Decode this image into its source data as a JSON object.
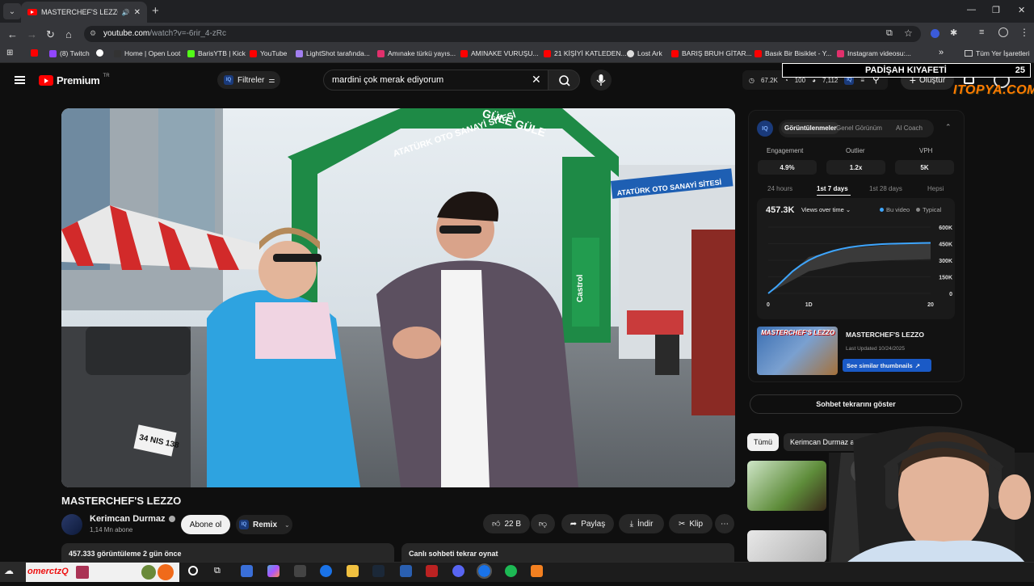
{
  "browser": {
    "tab_title": "MASTERCHEF'S LEZZO - Yo",
    "new_tab": "+",
    "url_host": "youtube.com",
    "url_path": "/watch?v=-6rir_4-zRc",
    "bookmarks": [
      "(8) Twitch",
      "Home | Open Loot",
      "BarisYTB | Kick",
      "YouTube",
      "LightShot tarafında...",
      "Amınake türkü yayıs...",
      "AMINAKE VURUŞU...",
      "21 KİŞİYİ KATLEDEN...",
      "Lost Ark",
      "BARIŞ BRUH GİTAR...",
      "Basık Bir Bisiklet - Y...",
      "Instagram videosu:..."
    ],
    "all_bookmarks": "Tüm Yer İşaretleri",
    "more": "»"
  },
  "youtube": {
    "logo": "Premium",
    "region": "TR",
    "filters": "Filtreler",
    "search_query": "mardini çok merak ediyorum",
    "stats": {
      "views": "67.2K",
      "likes": "100",
      "other": "7,112"
    },
    "create": "Oluştur"
  },
  "overlay": {
    "title": "PADİŞAH KIYAFETİ",
    "counter": "25",
    "brand": "ITOPYA.COM"
  },
  "video": {
    "title": "MASTERCHEF'S LEZZO",
    "channel": "Kerimcan Durmaz",
    "subscribers": "1,14 Mn abone",
    "subscribe": "Abone ol",
    "remix": "Remix",
    "likes": "22 B",
    "share": "Paylaş",
    "download": "İndir",
    "clip": "Klip",
    "description": "457.333 görüntüleme  2 gün önce",
    "live_chat": "Canlı sohbeti tekrar oynat",
    "banner_left": "ATATÜRK OTO SANAYİ SİTESİ",
    "banner_right": "GÜLE GÜLE",
    "sign_side": "ATATÜRK OTO SANAYİ SİTESİ",
    "brand_sign": "Castrol",
    "plate": "34 NIS 138"
  },
  "iq_panel": {
    "tabs": [
      "Görüntülenmeler",
      "Genel Görünüm",
      "AI Coach"
    ],
    "metrics": [
      {
        "label": "Engagement",
        "value": "4.9%"
      },
      {
        "label": "Outlier",
        "value": "1.2x"
      },
      {
        "label": "VPH",
        "value": "5K"
      }
    ],
    "ranges": [
      "24 hours",
      "1st 7 days",
      "1st 28 days",
      "Hepsi"
    ],
    "total": "457.3K",
    "dropdown": "Views over time",
    "legend": [
      "Bu video",
      "Typical"
    ],
    "thumb_title": "MASTERCHEF'S LEZZO",
    "last_updated": "Last Updated 10/24/2025",
    "similar_btn": "See similar thumbnails"
  },
  "chart_data": {
    "type": "area",
    "x_tick_labels": [
      "0",
      "1D",
      "20"
    ],
    "y_tick_labels": [
      "0",
      "150K",
      "300K",
      "450K",
      "600K"
    ],
    "ylim": [
      0,
      600000
    ],
    "series": [
      {
        "name": "Bu video",
        "kind": "line",
        "color": "#3ea6ff",
        "x": [
          0,
          1,
          2,
          3,
          4,
          5,
          6,
          7,
          8,
          9,
          10,
          11,
          12,
          13,
          14,
          15,
          16,
          17,
          18,
          19,
          20
        ],
        "values": [
          0,
          60000,
          130000,
          200000,
          255000,
          300000,
          335000,
          362000,
          385000,
          403000,
          417000,
          427000,
          435000,
          441000,
          446000,
          449000,
          451000,
          453000,
          455000,
          456000,
          457300
        ]
      },
      {
        "name": "Typical",
        "kind": "band",
        "color": "#3a3a3a",
        "x": [
          0,
          5,
          10,
          15,
          20
        ],
        "upper": [
          0,
          330000,
          410000,
          440000,
          460000
        ],
        "lower": [
          0,
          200000,
          280000,
          300000,
          310000
        ]
      }
    ]
  },
  "chat": {
    "show_chat": "Sohbet tekrarını göster",
    "chips": [
      "Tümü",
      "Kerimcan Durmaz adlı yükleyicid"
    ]
  },
  "taskbar": {
    "label": "omerctzQ"
  }
}
